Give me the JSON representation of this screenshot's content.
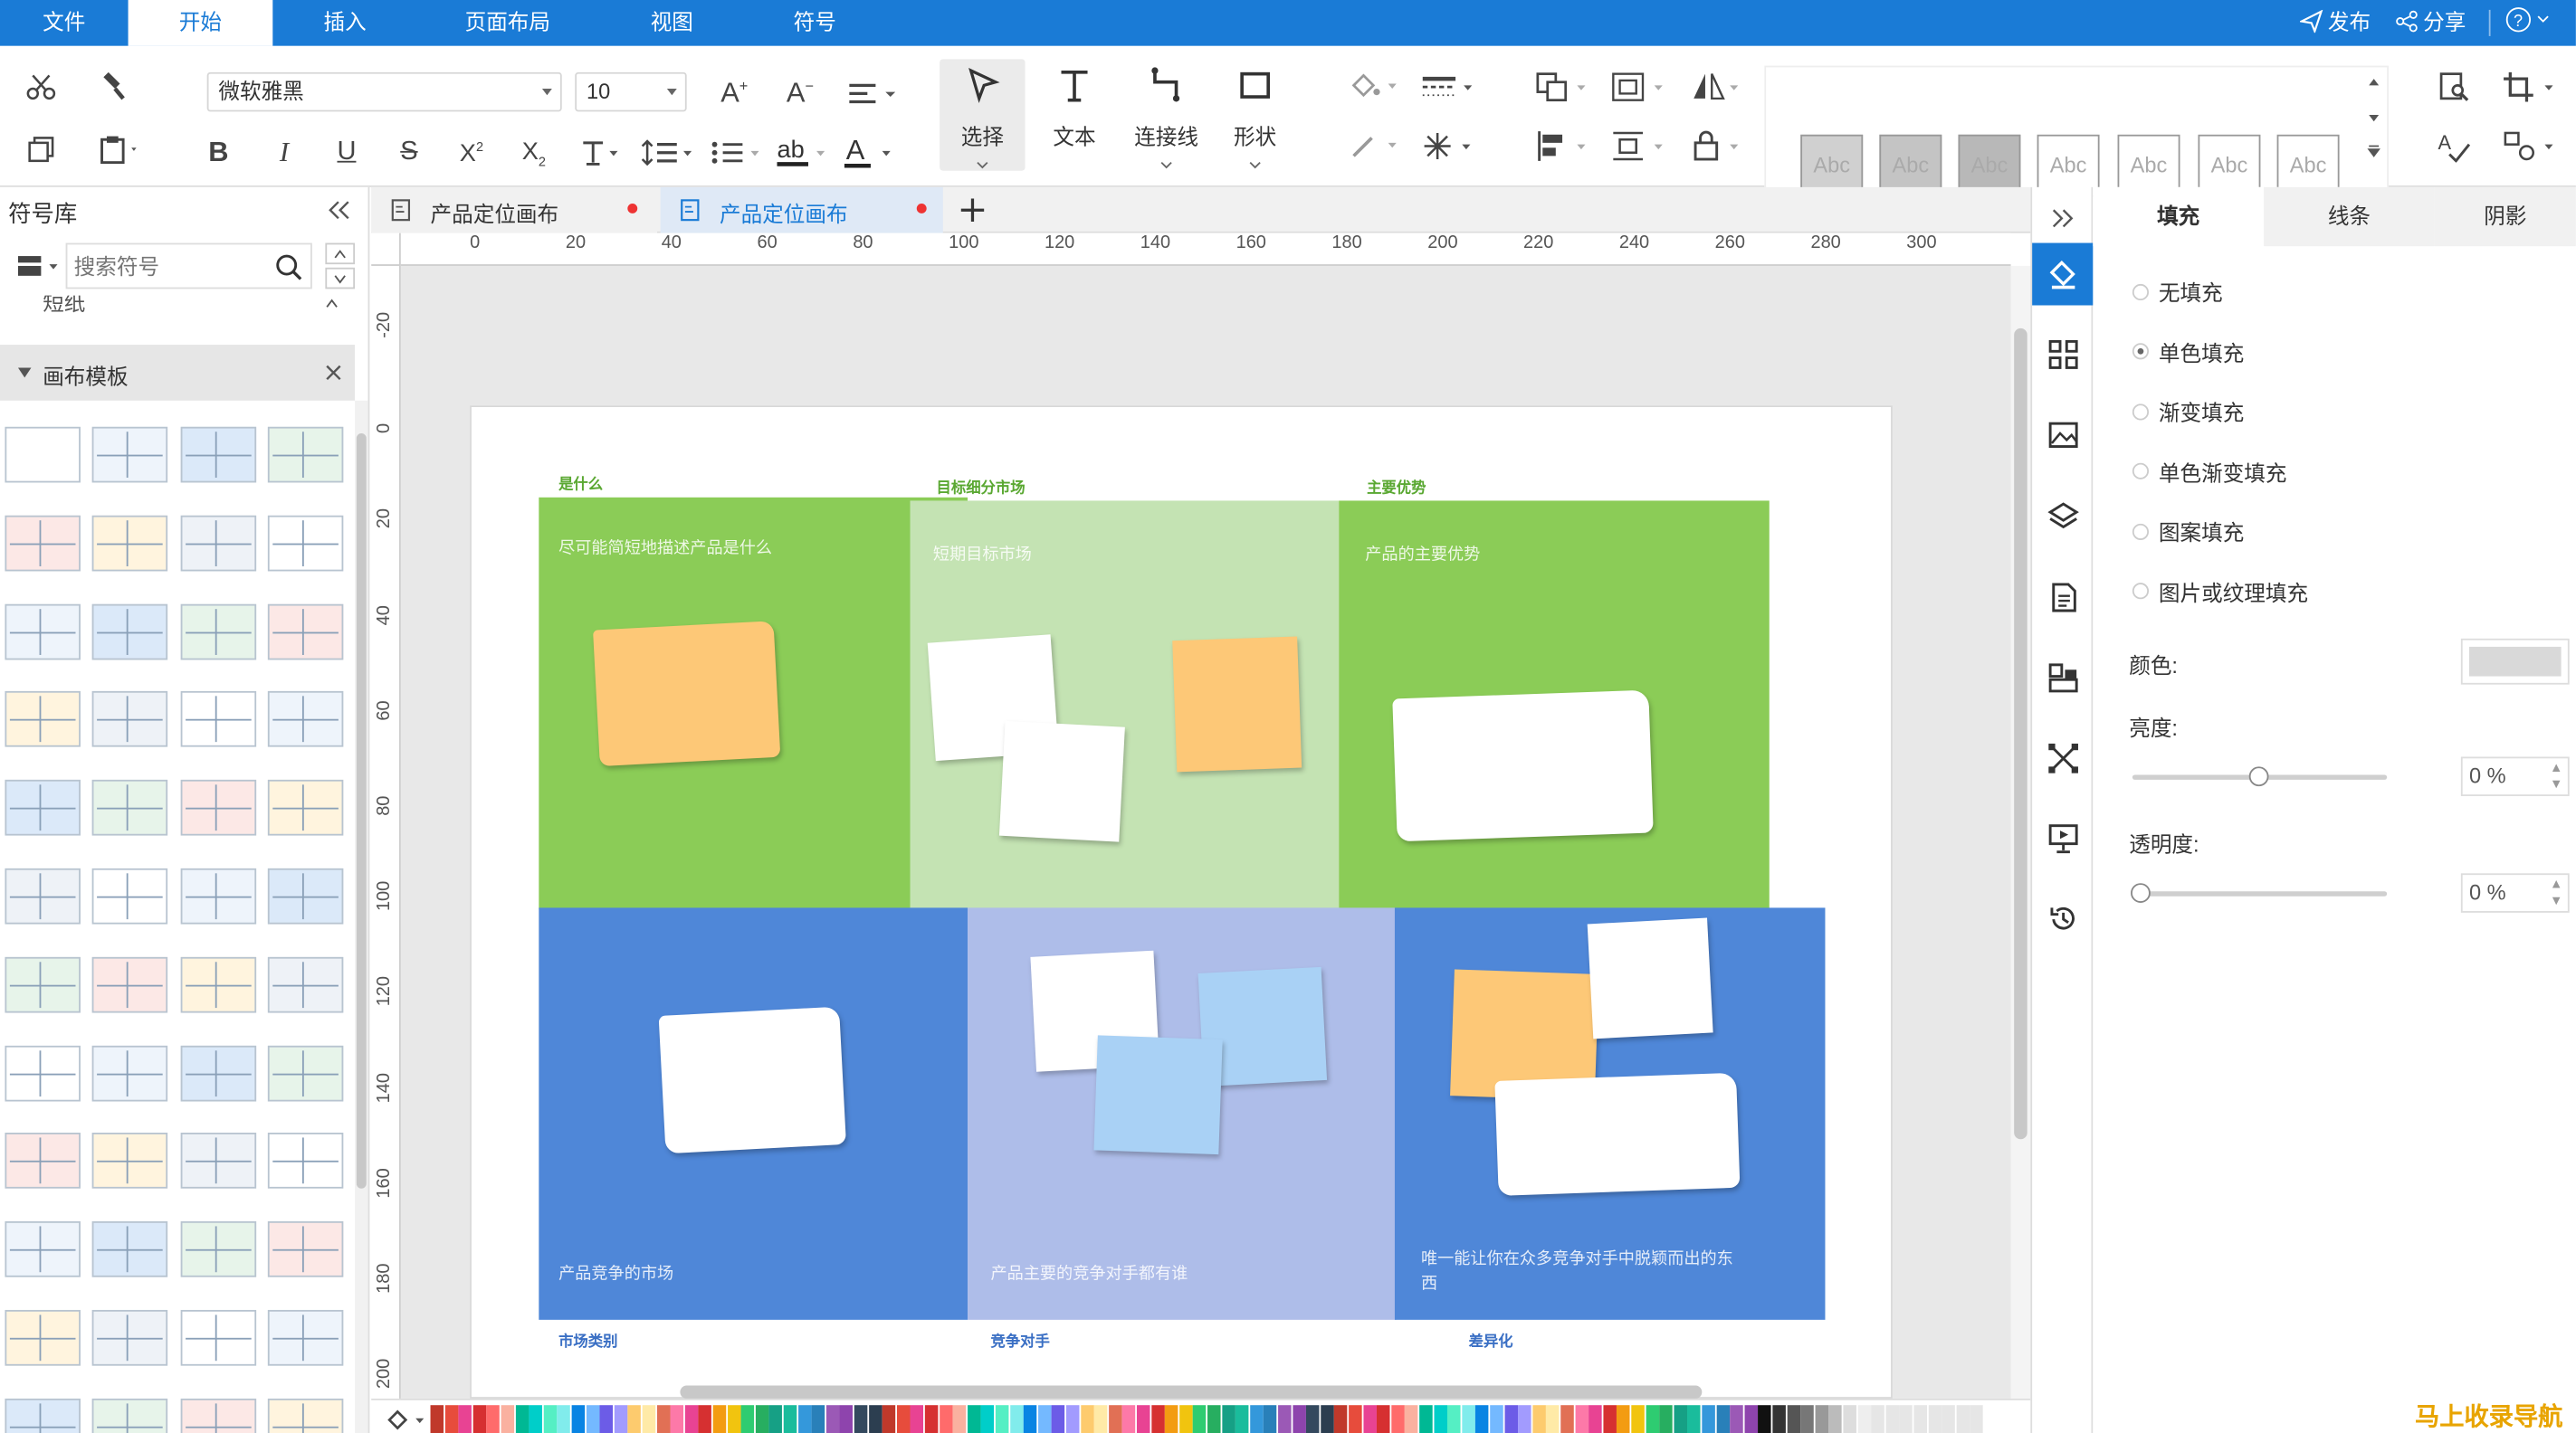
{
  "menu": {
    "file": "文件",
    "home": "开始",
    "insert": "插入",
    "layout": "页面布局",
    "view": "视图",
    "symbol": "符号",
    "publish": "发布",
    "share": "分享"
  },
  "ribbon": {
    "font": "微软雅黑",
    "size": "10",
    "select": "选择",
    "text": "文本",
    "connector": "连接线",
    "shape": "形状",
    "styles": [
      "Abc",
      "Abc",
      "Abc",
      "Abc",
      "Abc",
      "Abc",
      "Abc"
    ]
  },
  "left": {
    "title": "符号库",
    "search_placeholder": "搜索符号",
    "prev_section": "短纸",
    "section": "画布模板"
  },
  "tabs": [
    {
      "label": "产品定位画布"
    },
    {
      "label": "产品定位画布"
    }
  ],
  "ruler": {
    "h": [
      "0",
      "20",
      "40",
      "60",
      "80",
      "100",
      "120",
      "140",
      "160",
      "180",
      "200",
      "220",
      "240",
      "260",
      "280",
      "300"
    ],
    "v": [
      "-20",
      "0",
      "20",
      "40",
      "60",
      "80",
      "100",
      "120",
      "140",
      "160",
      "180",
      "200"
    ]
  },
  "canvas": {
    "top_titles": [
      "是什么",
      "目标细分市场",
      "主要优势"
    ],
    "bottom_titles": [
      "市场类别",
      "竞争对手",
      "差异化"
    ],
    "cells": {
      "what": "尽可能简短地描述产品是什么",
      "target": "短期目标市场",
      "adv": "产品的主要优势",
      "market": "产品竞争的市场",
      "comp": "产品主要的竞争对手都有谁",
      "diff": "唯一能让你在众多竞争对手中脱颖而出的东西"
    },
    "colors": {
      "green": "#8bcc57",
      "lightgreen": "#c4e3b3",
      "blue": "#4f87d8",
      "lightblue": "#aebde9",
      "orange": "#fdc877",
      "white": "#ffffff",
      "paleblue": "#a9d1f5"
    }
  },
  "right": {
    "tabs": [
      "填充",
      "线条",
      "阴影"
    ],
    "options": [
      "无填充",
      "单色填充",
      "渐变填充",
      "单色渐变填充",
      "图案填充",
      "图片或纹理填充"
    ],
    "selected": "单色填充",
    "color_label": "颜色:",
    "brightness_label": "亮度:",
    "brightness": "0 %",
    "transparency_label": "透明度:",
    "transparency": "0 %"
  },
  "watermark": "马上收录导航"
}
